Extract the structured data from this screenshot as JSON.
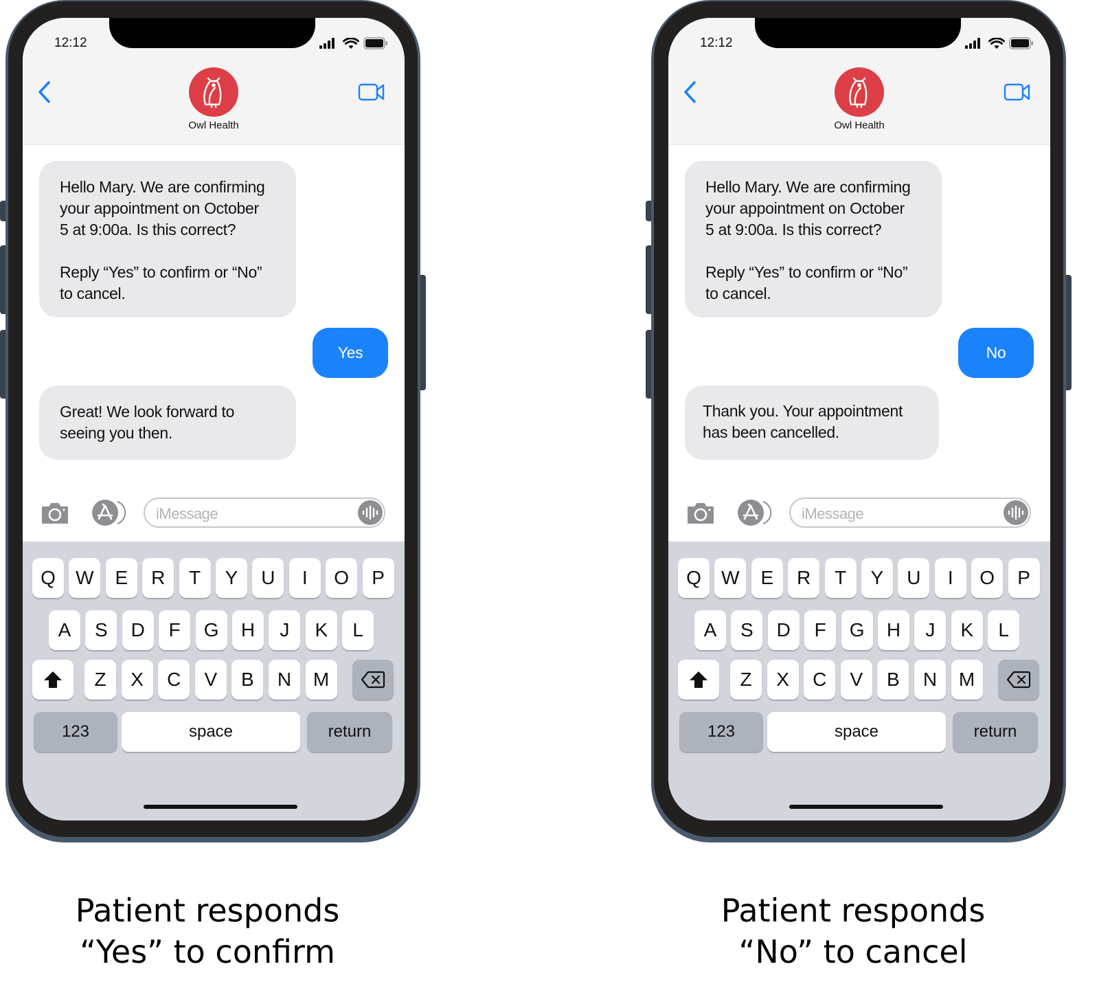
{
  "phones": [
    {
      "status_time": "12:12",
      "contact_name": "Owl Health",
      "avatar_color": "#dd3e47",
      "messages": [
        {
          "sender": "business",
          "text": "Hello Mary. We are confirming\nyour appointment on October\n5 at 9:00a.  Is this correct?\n\nReply “Yes” to confirm or “No”\nto cancel."
        },
        {
          "sender": "patient",
          "text": "Yes"
        },
        {
          "sender": "business",
          "text": "Great! We look forward to\nseeing you then."
        }
      ],
      "input_placeholder": "iMessage",
      "caption": "Patient responds\n“Yes” to confirm"
    },
    {
      "status_time": "12:12",
      "contact_name": "Owl Health",
      "avatar_color": "#dd3e47",
      "messages": [
        {
          "sender": "business",
          "text": "Hello Mary. We are confirming\nyour appointment on October\n5 at 9:00a.  Is this correct?\n\nReply “Yes” to confirm or “No”\nto cancel."
        },
        {
          "sender": "patient",
          "text": "No"
        },
        {
          "sender": "business",
          "text": "Thank you. Your appointment\nhas been cancelled."
        }
      ],
      "input_placeholder": "iMessage",
      "caption": "Patient responds\n“No” to cancel"
    }
  ],
  "keyboard": {
    "row1": [
      "Q",
      "W",
      "E",
      "R",
      "T",
      "Y",
      "U",
      "I",
      "O",
      "P"
    ],
    "row2": [
      "A",
      "S",
      "D",
      "F",
      "G",
      "H",
      "J",
      "K",
      "L"
    ],
    "row3": [
      "Z",
      "X",
      "C",
      "V",
      "B",
      "N",
      "M"
    ],
    "numbers_label": "123",
    "space_label": "space",
    "return_label": "return",
    "shift_icon": "shift-icon",
    "delete_icon": "delete-icon"
  },
  "colors": {
    "outgoing_bubble": "#1a82fb",
    "incoming_bubble": "#e9e9eb",
    "ios_blue": "#1a82fb"
  }
}
